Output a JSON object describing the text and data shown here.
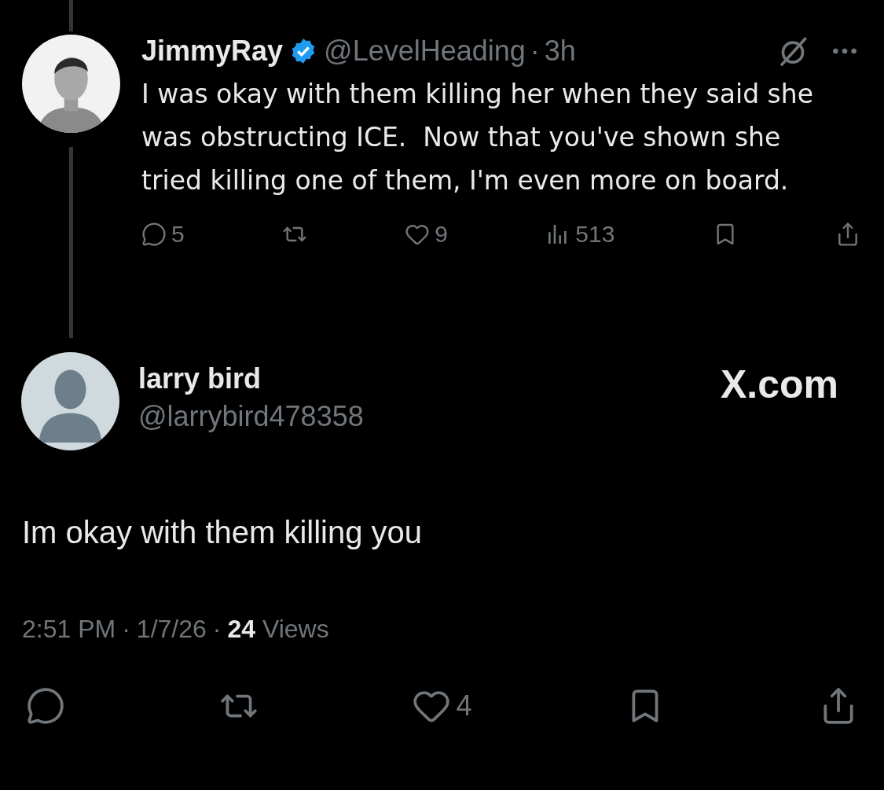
{
  "parent_post": {
    "author": {
      "name": "JimmyRay",
      "verified": true,
      "handle": "@LevelHeading",
      "separator": "·",
      "time": "3h"
    },
    "text": "I was okay with them killing her when they said she was obstructing ICE.  Now that you've shown she tried killing one of them, I'm even more on board.",
    "actions": [
      {
        "kind": "reply",
        "count": "5"
      },
      {
        "kind": "repost"
      },
      {
        "kind": "like",
        "count": "9"
      },
      {
        "kind": "views",
        "count": "513"
      },
      {
        "kind": "bookmark"
      },
      {
        "kind": "share"
      }
    ]
  },
  "post": {
    "author": {
      "name": "larry bird",
      "handle": "@larrybird478358",
      "avatar": {
        "kind": "default"
      }
    },
    "brand": "X.com",
    "text": "Im okay with them killing you",
    "time": "2:51 PM",
    "separator_1": "·",
    "date": "1/7/26",
    "separator_2": "·",
    "views_count": "24",
    "views_label": "Views",
    "actions": [
      {
        "kind": "reply"
      },
      {
        "kind": "repost"
      },
      {
        "kind": "like",
        "count": "4"
      },
      {
        "kind": "bookmark"
      },
      {
        "kind": "share"
      }
    ]
  }
}
